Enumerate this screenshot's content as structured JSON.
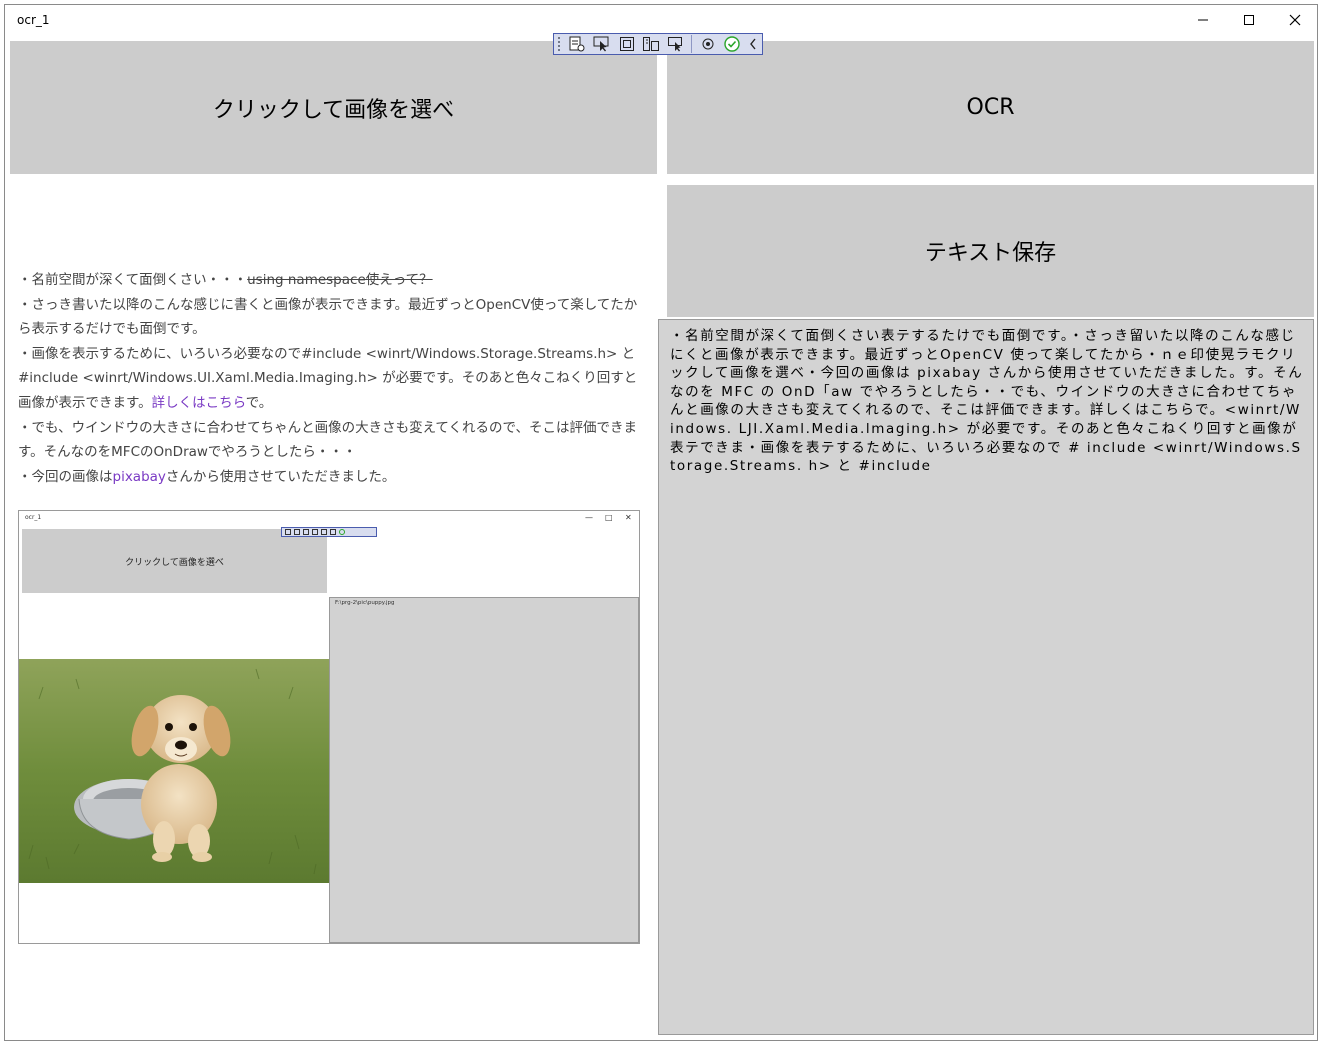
{
  "window": {
    "title": "ocr_1",
    "controls": {
      "minimize": "minimize-icon",
      "maximize": "maximize-icon",
      "close": "close-icon"
    }
  },
  "buttons": {
    "select_image": "クリックして画像を選べ",
    "ocr": "OCR",
    "save_text": "テキスト保存"
  },
  "debug_toolbar": {
    "icons": [
      "live-visual-tree-icon",
      "select-element-icon",
      "display-layout-adorners-icon",
      "track-focus-icon",
      "show-hot-reload-icon",
      "binding-failures-icon",
      "check-accessibility-icon",
      "collapse-chevron-icon"
    ],
    "check_color": "#2aa52a",
    "border_color": "#4a5cae"
  },
  "article": {
    "para1_prefix": "・名前空間が深くて面倒くさい・・・",
    "para1_strike": "using namespace使えって？",
    "para2": "・さっき書いた以降のこんな感じに書くと画像が表示できます。最近ずっとOpenCV使って楽してたから表示するだけでも面倒です。",
    "para3_text": "・画像を表示するために、いろいろ必要なので#include <winrt/Windows.Storage.Streams.h> と#include <winrt/Windows.UI.Xaml.Media.Imaging.h> が必要です。そのあと色々こねくり回すと画像が表示できます。",
    "para3_link": "詳しくはこちら",
    "para3_suffix": "で。",
    "para4": "・でも、ウインドウの大きさに合わせてちゃんと画像の大きさも変えてくれるので、そこは評価できます。そんなのをMFCのOnDrawでやろうとしたら・・・",
    "para5_prefix": "・今回の画像は",
    "para5_link": "pixabay",
    "para5_suffix": "さんから使用させていただきました。",
    "link_color": "#7a3ac4"
  },
  "embedded_screenshot": {
    "title": "ocr_1",
    "min": "—",
    "max": "□",
    "close": "✕",
    "button_label": "クリックして画像を選べ",
    "file_path": "F:\\prg-2\\pic\\puppy.jpg",
    "image": "puppy-in-bowl-photo"
  },
  "ocr_result": {
    "text": "・名前空間が深くて面倒くさい表テするたけでも面倒です。・さっき留いた以降のこんな感じにくと画像が表示できます。最近ずっとOpenCV 使って楽してたから・ｎｅ印使晃ラモクリックして画像を選べ・今回の画像は pixabay さんから使用させていただきました。す。そんなのを MFC の OnD「aw でやろうとしたら・・でも、ウインドウの大きさに合わせてちゃんと画像の大きさも変えてくれるので、そこは評価できます。詳しくはこちらで。<winrt/Windows. LJI.Xaml.Media.lmaging.h> が必要です。そのあと色々こねくり回すと画像が表テできま・画像を表テするために、いろいろ必要なので # include <winrt/Windows.Storage.Streams. h> と #include"
  },
  "colors": {
    "button_bg": "#cccccc",
    "panel_bg": "#d3d3d3"
  }
}
